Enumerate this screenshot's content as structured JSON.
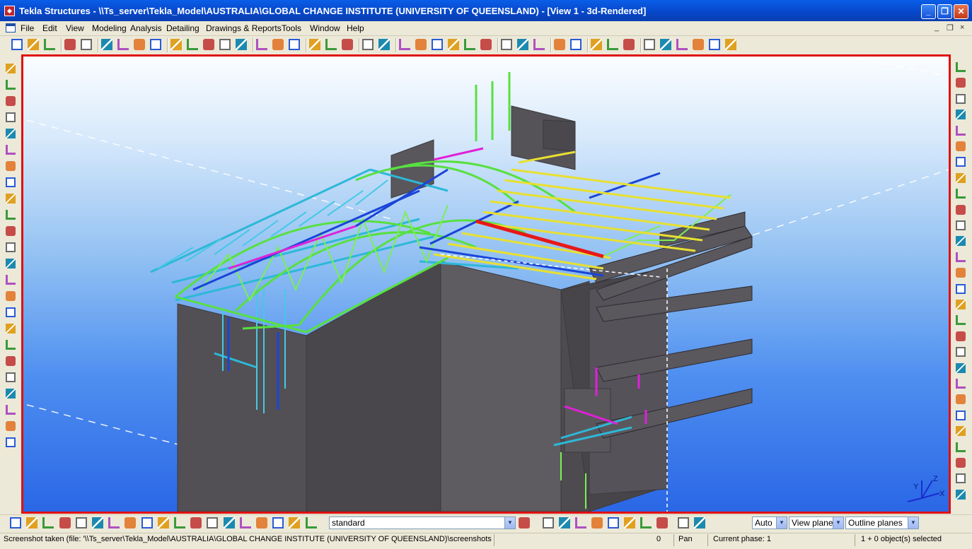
{
  "window": {
    "title": "Tekla Structures - \\\\Ts_server\\Tekla_Model\\AUSTRALIA\\GLOBAL CHANGE INSTITUTE (UNIVERSITY OF QUEENSLAND) - [View 1 - 3d-Rendered]",
    "minimize": "_",
    "maximize": "❐",
    "close": "✕"
  },
  "menu": {
    "items": [
      "File",
      "Edit",
      "View",
      "Modeling",
      "Analysis",
      "Detailing",
      "Drawings & Reports",
      "Tools",
      "Window",
      "Help"
    ],
    "mdi_minimize": "_",
    "mdi_restore": "❐",
    "mdi_close": "×"
  },
  "bottom_toolbar": {
    "selection_filter": "standard",
    "snap_depth": "Auto",
    "work_plane": "View plane",
    "plane_type": "Outline planes"
  },
  "viewport": {
    "axis_z": "Z",
    "axis_y": "Y",
    "axis_x": "X",
    "border_color": "#e01010",
    "sky_top": "#fbfdff",
    "sky_bottom": "#2a67e6"
  },
  "status": {
    "message": "Screenshot taken (file: '\\\\Ts_server\\Tekla_Model\\AUSTRALIA\\GLOBAL CHANGE INSTITUTE (UNIVERSITY OF QUEENSLAND)\\screenshots\\snap_",
    "counter": "0",
    "mode": "Pan",
    "phase": "Current phase: 1",
    "selection": "1 + 0 object(s) selected"
  },
  "icons": {
    "top": [
      "new-icon",
      "open-icon",
      "save-icon",
      "undo-icon",
      "redo-icon",
      "copy-icon",
      "paste-icon",
      "print-icon",
      "properties-icon",
      "window-icon",
      "window2-icon",
      "scissors-icon",
      "select-icon",
      "part-icon",
      "assembly-icon",
      "component-icon",
      "drawing-icon",
      "move-icon",
      "rotate-icon",
      "snap-icon",
      "zoom-icon",
      "help-icon",
      "grid-icon",
      "dimension-icon",
      "cross-icon",
      "angle-icon",
      "arc-icon",
      "measure-icon",
      "pick-icon",
      "clash-icon",
      "report-icon",
      "numbering-icon",
      "tekla-icon",
      "forward-icon",
      "catalog-icon",
      "list-icon",
      "view-icon",
      "layout-icon",
      "filter-icon",
      "hammer-icon",
      "check-icon",
      "export-icon"
    ],
    "left": [
      "column-icon",
      "beam-icon",
      "polybeam-icon",
      "curved-beam-icon",
      "slab-icon",
      "pad-icon",
      "anchor-icon",
      "line-icon",
      "diagonal-icon",
      "brace-icon",
      "brace2-icon",
      "brace3-icon",
      "point-icon",
      "line2-icon",
      "circle-icon",
      "binoculars-icon",
      "tool-icon",
      "group-icon",
      "box-icon",
      "weld-icon",
      "bolt-icon",
      "cut-icon",
      "fitting-icon",
      "chamfer-icon"
    ],
    "right": [
      "view-front-icon",
      "rotate-view-icon",
      "binoculars-icon",
      "arrow-left-icon",
      "arrow-right-icon",
      "level-icon",
      "section-i-icon",
      "section-box-icon",
      "section-rect-icon",
      "section-h-icon",
      "section-c-icon",
      "section-z-icon",
      "section-t-icon",
      "section-l-icon",
      "section-yellow-icon",
      "section-circle-icon",
      "section-plate-icon",
      "section-double-icon",
      "section-box2-icon",
      "section-pipe-icon",
      "section-base-icon",
      "section-base2-icon",
      "section-col-icon",
      "section-frame-icon",
      "section-post-icon",
      "section-tower-icon",
      "section-cone-icon",
      "section-tri-icon"
    ],
    "bottom": [
      "select-all-icon",
      "select-part-icon",
      "select-surface-icon",
      "select-grid-icon",
      "select-assembly-icon",
      "select-component-icon",
      "select-cut-icon",
      "select-bolt-icon",
      "select-weld-icon",
      "select-view-icon",
      "select-point-icon",
      "select-plane-icon",
      "select-object-icon",
      "snap-point-icon",
      "snap-end-icon",
      "snap-mid-icon",
      "filter-settings-icon",
      "snap-ref-icon",
      "snap-geom-icon",
      "snap-center-icon",
      "snap-intersect-icon",
      "snap-perp-icon",
      "snap-ext-icon",
      "snap-any-icon",
      "snap-line-icon",
      "snap-check-icon",
      "snap-free-icon",
      "snap-arrow-icon",
      "representation-icon",
      "components-icon"
    ]
  }
}
